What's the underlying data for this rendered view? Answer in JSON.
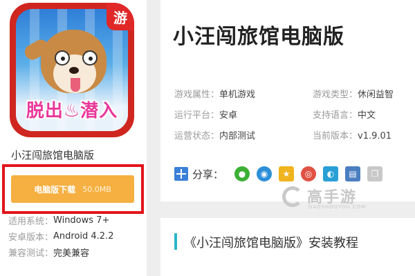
{
  "app": {
    "name": "小汪闯旅馆电脑版",
    "icon_badge": "游",
    "icon_banner": "脱出♨潜入"
  },
  "download": {
    "label": "电脑版下载",
    "size": "50.0MB"
  },
  "specs": [
    {
      "key": "适用系统：",
      "value": "Windows 7+"
    },
    {
      "key": "安卓版本：",
      "value": "Android 4.2.2"
    },
    {
      "key": "兼容测试：",
      "value": "完美兼容"
    }
  ],
  "details": {
    "title": "小汪闯旅馆电脑版",
    "attributes": [
      [
        {
          "key": "游戏属性：",
          "value": "单机游戏"
        },
        {
          "key": "游戏类型：",
          "value": "休闲益智"
        }
      ],
      [
        {
          "key": "运行平台：",
          "value": "安卓"
        },
        {
          "key": "支持语言：",
          "value": "中文"
        }
      ],
      [
        {
          "key": "运营状态：",
          "value": "内部测试"
        },
        {
          "key": "当前版本：",
          "value": "v1.9.01"
        }
      ]
    ]
  },
  "share": {
    "label": "分享：",
    "icons": [
      {
        "name": "wechat-icon",
        "color": "#3cb034"
      },
      {
        "name": "qq-icon",
        "color": "#2d8fd8"
      },
      {
        "name": "qzone-icon",
        "color": "#f0b41e"
      },
      {
        "name": "weibo-icon",
        "color": "#e05244"
      },
      {
        "name": "tencent-weibo-icon",
        "color": "#2a9fd6"
      },
      {
        "name": "print-icon",
        "color": "#4a7ec0"
      },
      {
        "name": "copy-icon",
        "color": "#c8c8c8"
      }
    ]
  },
  "watermark": {
    "text": "高手游",
    "sub": "GAOSHOUYOU.COM"
  },
  "tutorial": {
    "title": "《小汪闯旅馆电脑版》安装教程"
  },
  "colors": {
    "download_button": "#f5b041",
    "highlight_frame": "#e3141b",
    "section_accent": "#2bb5c8"
  }
}
